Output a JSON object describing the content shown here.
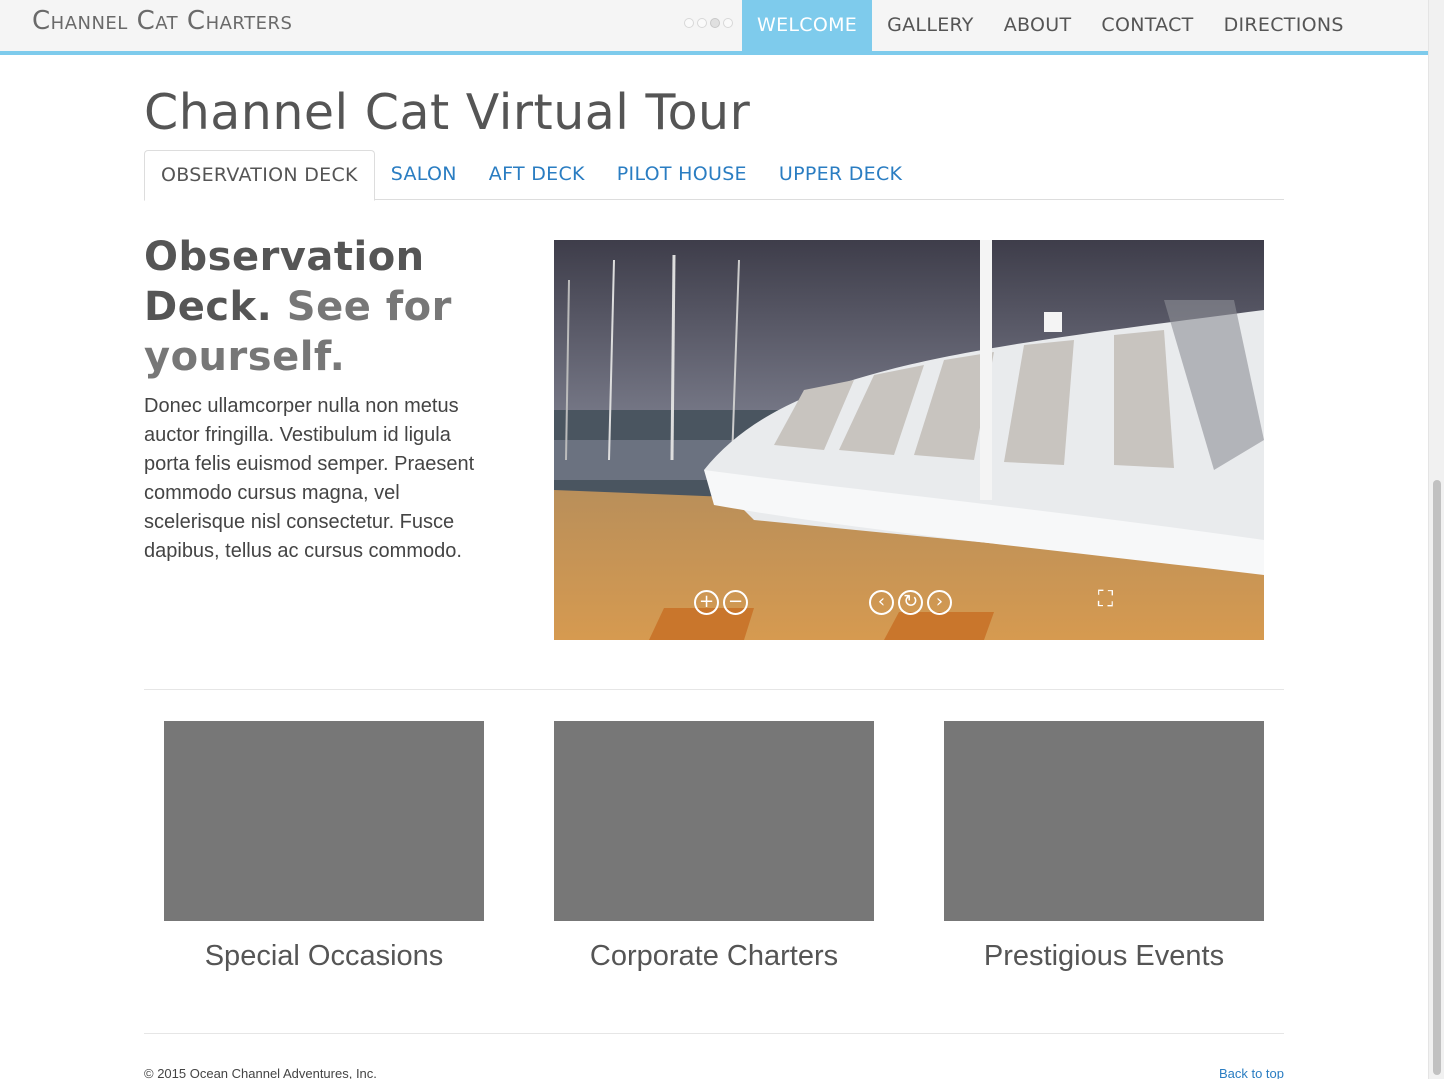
{
  "brand": "Channel Cat Charters",
  "nav": {
    "items": [
      {
        "label": "WELCOME",
        "active": true
      },
      {
        "label": "GALLERY"
      },
      {
        "label": "ABOUT"
      },
      {
        "label": "CONTACT"
      },
      {
        "label": "DIRECTIONS"
      }
    ]
  },
  "page_title": "Channel Cat Virtual Tour",
  "tabs": [
    {
      "label": "OBSERVATION DECK",
      "active": true
    },
    {
      "label": "SALON"
    },
    {
      "label": "AFT DECK"
    },
    {
      "label": "PILOT HOUSE"
    },
    {
      "label": "UPPER DECK"
    }
  ],
  "feature": {
    "heading_strong": "Observation Deck.",
    "heading_muted": "See for yourself.",
    "text": "Donec ullamcorper nulla non metus auctor fringilla. Vestibulum id ligula porta felis euismod semper. Praesent commodo cursus magna, vel scelerisque nisl consectetur. Fusce dapibus, tellus ac cursus commodo."
  },
  "pano_controls": {
    "zoom_in": "+",
    "zoom_out": "−",
    "prev": "‹",
    "autoplay": "↻",
    "next": "›",
    "fullscreen": "⛶"
  },
  "cards": [
    {
      "title": "Special Occasions"
    },
    {
      "title": "Corporate Charters"
    },
    {
      "title": "Prestigious Events"
    }
  ],
  "footer": {
    "copyright": "© 2015 Ocean Channel Adventures, Inc.",
    "back_to_top": "Back to top"
  },
  "colors": {
    "accent": "#7ecbec",
    "link": "#2a7dc2",
    "placeholder": "#777777"
  }
}
